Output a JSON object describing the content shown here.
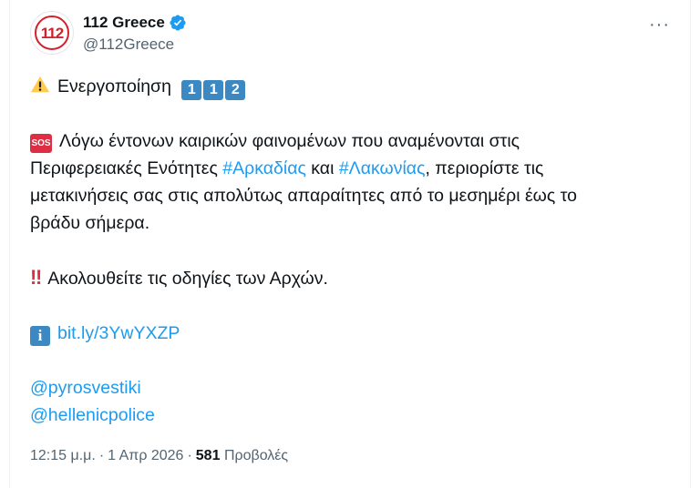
{
  "tweet": {
    "display_name": "112 Greece",
    "handle": "@112Greece",
    "avatar_text": "112",
    "more_icon": "···",
    "line1": {
      "text": "Ενεργοποίηση",
      "keycaps": [
        "1",
        "1",
        "2"
      ]
    },
    "paragraph2": {
      "badge": "SOS",
      "l1": "Λόγω έντονων καιρικών φαινομένων που αναμένονται στις",
      "l2_pre": "Περιφερειακές Ενότητες ",
      "l2_tag1": "#Αρκαδίας",
      "l2_mid": " και ",
      "l2_tag2": "#Λακωνίας",
      "l2_post": ",  περιορίστε τις",
      "l3": "μετακινήσεις σας στις απολύτως απαραίτητες από το μεσημέρι έως το",
      "l4": "βράδυ σήμερα."
    },
    "paragraph3": {
      "badge": "‼",
      "text": "Ακολουθείτε τις οδηγίες των Αρχών."
    },
    "paragraph4": {
      "badge": "i",
      "link": "bit.ly/3YwYXZP"
    },
    "mentions": [
      "@pyrosvestiki",
      "@hellenicpolice"
    ],
    "meta": {
      "time": "12:15 μ.μ.",
      "dot": "·",
      "date": "1 Απρ 2026",
      "views_count": "581",
      "views_label": "Προβολές"
    }
  }
}
